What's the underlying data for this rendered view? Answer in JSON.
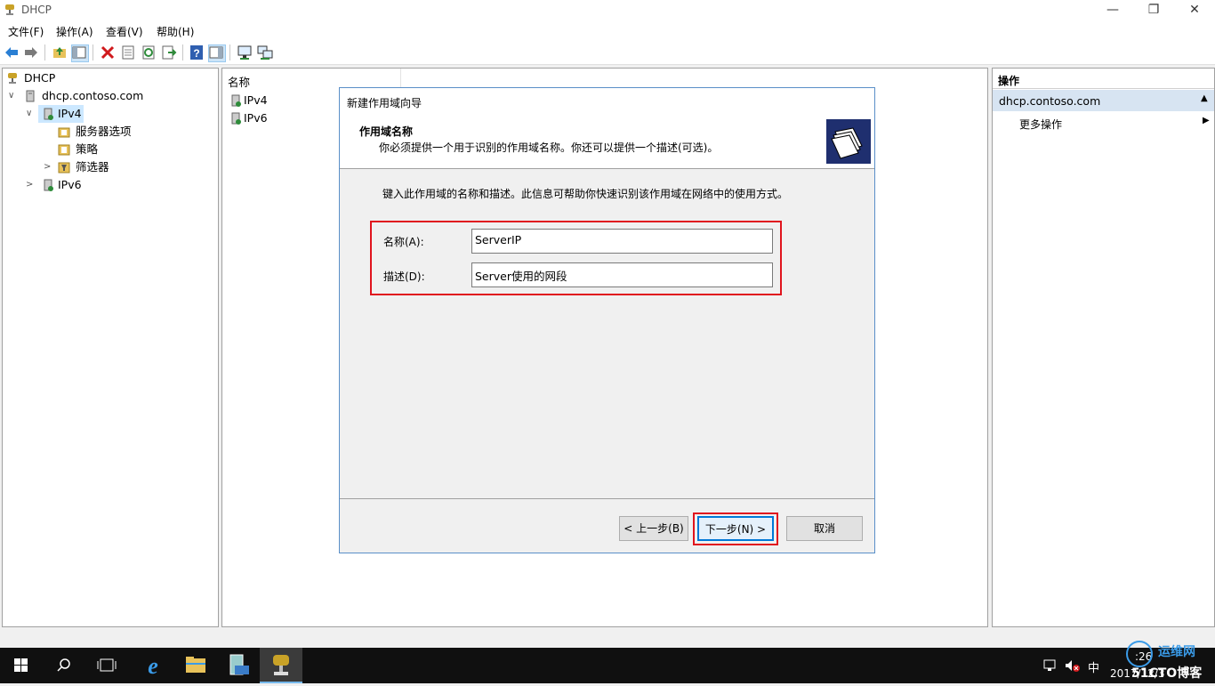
{
  "window": {
    "title": "DHCP",
    "minimize_glyph": "—",
    "restore_glyph": "❐",
    "close_glyph": "✕"
  },
  "menu": [
    "文件(F)",
    "操作(A)",
    "查看(V)",
    "帮助(H)"
  ],
  "toolbar": {
    "icons": [
      "back-arrow-icon",
      "forward-arrow-icon",
      "up-folder-icon",
      "show-hide-tree-icon",
      "delete-icon",
      "properties-icon",
      "refresh-icon",
      "export-icon",
      "help-icon",
      "show-action-pane-icon",
      "monitor-icon",
      "network-icon"
    ]
  },
  "tree": {
    "root": "DHCP",
    "server": "dhcp.contoso.com",
    "ipv4": "IPv4",
    "server_options": "服务器选项",
    "policies": "策略",
    "filters": "筛选器",
    "ipv6": "IPv6"
  },
  "list": {
    "column_header": "名称",
    "items": [
      "IPv4",
      "IPv6"
    ]
  },
  "wizard": {
    "title": "新建作用域向导",
    "heading": "作用域名称",
    "subheading": "你必须提供一个用于识别的作用域名称。你还可以提供一个描述(可选)。",
    "instruction": "键入此作用域的名称和描述。此信息可帮助你快速识别该作用域在网络中的使用方式。",
    "name_label": "名称(A):",
    "name_value": "ServerIP",
    "desc_label": "描述(D):",
    "desc_value": "Server使用的网段",
    "back_button": "< 上一步(B)",
    "next_button": "下一步(N) >",
    "cancel_button": "取消"
  },
  "actions_pane": {
    "header": "操作",
    "section": "dhcp.contoso.com",
    "more_actions": "更多操作"
  },
  "taskbar": {
    "clock_time": ":26",
    "clock_date": "2017/12/3",
    "ime": "中",
    "watermark_brand": "运维网",
    "watermark_site": "51CTO博客"
  },
  "colors": {
    "accent_selected": "#cce8ff",
    "highlight_red": "#e0141e",
    "dialog_border": "#5a8fc8",
    "action_header_bg": "#d7e4f2",
    "taskbar_bg": "#101010"
  }
}
